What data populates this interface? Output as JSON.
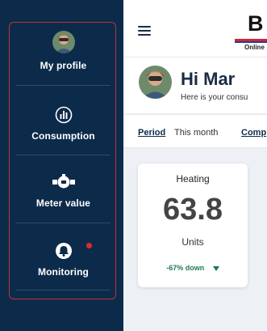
{
  "sidebar": {
    "items": [
      {
        "label": "My profile",
        "icon": "avatar"
      },
      {
        "label": "Consumption",
        "icon": "chart-icon"
      },
      {
        "label": "Meter value",
        "icon": "meter-icon"
      },
      {
        "label": "Monitoring",
        "icon": "bell-icon",
        "has_notification": true
      }
    ],
    "frame_color": "#c0303a",
    "background": "#0c2b4b"
  },
  "header": {
    "logo_letter": "B",
    "logo_sub": "Online"
  },
  "greeting": {
    "title": "Hi Mar",
    "subtitle": "Here is your consu"
  },
  "period": {
    "label": "Period",
    "value": "This month",
    "compare_label": "Comp"
  },
  "card": {
    "title": "Heating",
    "value": "63.8",
    "unit": "Units",
    "trend": "-67% down",
    "trend_color": "#1e7a4e"
  }
}
